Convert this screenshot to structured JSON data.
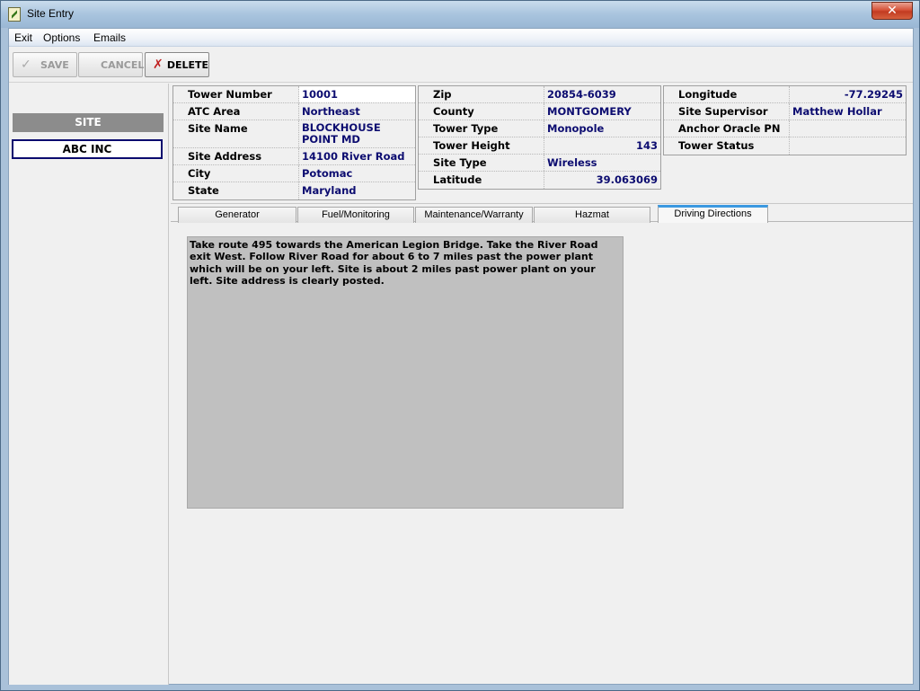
{
  "window": {
    "title": "Site Entry",
    "close_glyph": "✕"
  },
  "menu": [
    "Exit",
    "Options",
    "Emails"
  ],
  "toolbar": {
    "save_label": "SAVE",
    "cancel_label": "CANCEL",
    "delete_label": "DELETE"
  },
  "sidebar": {
    "header": "SITE",
    "items": [
      {
        "label": "ABC INC"
      }
    ]
  },
  "fields": {
    "col1": [
      {
        "label": "Tower Number",
        "value": "10001"
      },
      {
        "label": "ATC Area",
        "value": "Northeast"
      },
      {
        "label": "Site Name",
        "value": "BLOCKHOUSE POINT MD"
      },
      {
        "label": "Site Address",
        "value": "14100 River Road"
      },
      {
        "label": "City",
        "value": "Potomac"
      },
      {
        "label": "State",
        "value": "Maryland"
      }
    ],
    "col2": [
      {
        "label": "Zip",
        "value": "20854-6039"
      },
      {
        "label": "County",
        "value": "MONTGOMERY"
      },
      {
        "label": "Tower Type",
        "value": "Monopole"
      },
      {
        "label": "Tower Height",
        "value": "143"
      },
      {
        "label": "Site Type",
        "value": "Wireless"
      },
      {
        "label": "Latitude",
        "value": "39.063069"
      }
    ],
    "col3": [
      {
        "label": "Longitude",
        "value": "-77.29245"
      },
      {
        "label": "Site Supervisor",
        "value": "Matthew Hollar"
      },
      {
        "label": "Anchor Oracle PN",
        "value": ""
      },
      {
        "label": "Tower Status",
        "value": ""
      }
    ]
  },
  "tabs": [
    {
      "label": "Generator"
    },
    {
      "label": "Fuel/Monitoring"
    },
    {
      "label": "Maintenance/Warranty"
    },
    {
      "label": "Hazmat"
    },
    {
      "label": "Driving Directions"
    }
  ],
  "selected_tab": "Driving Directions",
  "directions_text": "Take route 495 towards the American Legion Bridge. Take the River Road exit West. Follow River Road for about 6 to 7 miles past the power plant which will be on your left. Site is about 2 miles past power plant on your left. Site address is clearly posted.",
  "colors": {
    "accent_tab": "#3b99e0",
    "value_text": "#0c0c70",
    "site_item_border": "#0b0b6e",
    "delete_icon": "#c02020"
  }
}
